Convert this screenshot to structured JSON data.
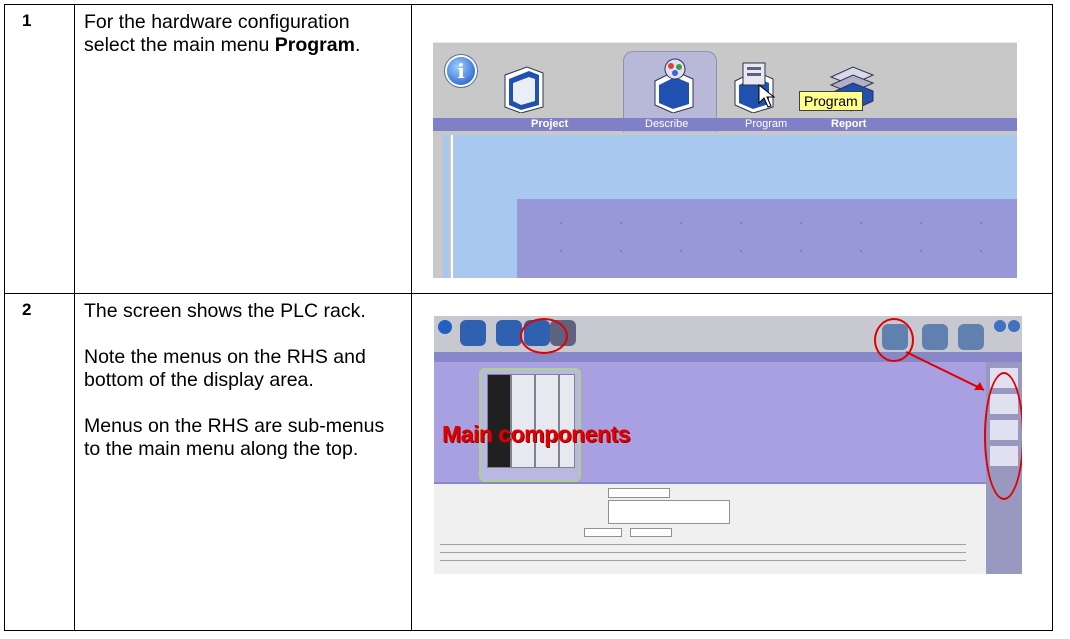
{
  "rows": [
    {
      "number": "1",
      "paragraphs": [
        {
          "before": "For the hardware configuration select the main menu ",
          "bold": "Program",
          "after": "."
        }
      ],
      "screenshot": {
        "info_icon": "i",
        "tabs": [
          "Project",
          "Describe",
          "Program",
          "Report"
        ],
        "tooltip": "Program",
        "icons": [
          "project-folder-icon",
          "describe-icon",
          "program-icon",
          "report-icon"
        ]
      }
    },
    {
      "number": "2",
      "paragraphs": [
        {
          "text": "The screen shows the PLC rack."
        },
        {
          "text": "Note the menus on the RHS and bottom of the display area."
        },
        {
          "text": "Menus on the RHS are sub-menus to the main menu along the top."
        }
      ],
      "screenshot": {
        "overlay_caption": "Main components",
        "colors": {
          "highlight": "#e00000"
        }
      }
    }
  ]
}
